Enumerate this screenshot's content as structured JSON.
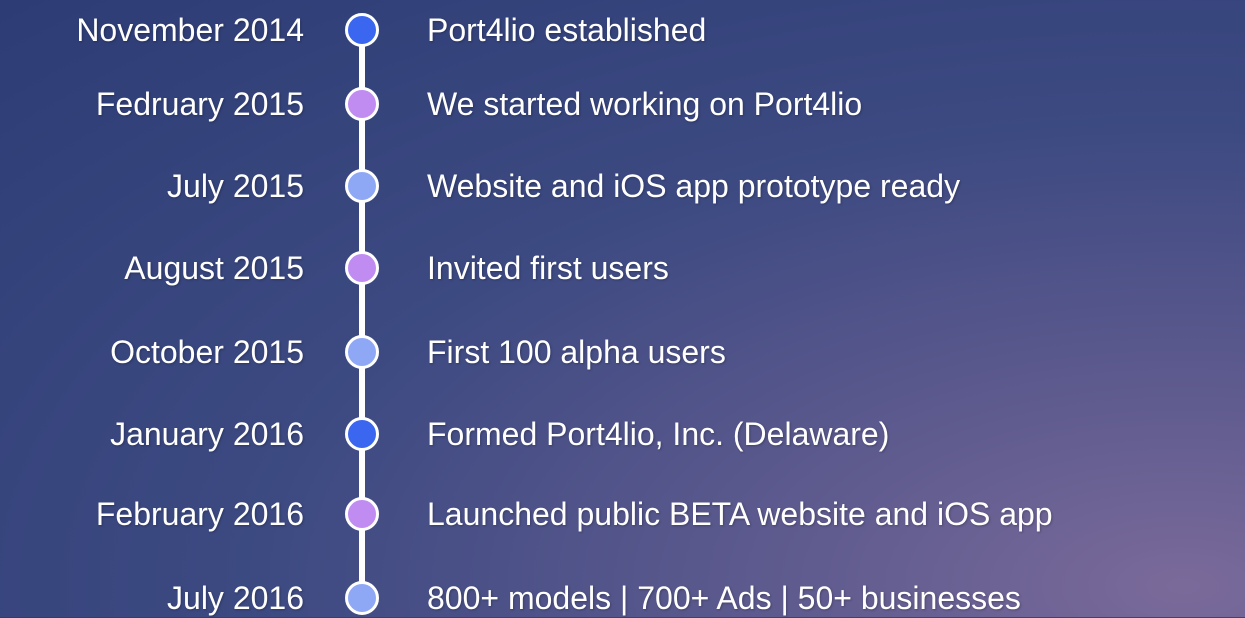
{
  "timeline": [
    {
      "date": "November 2014",
      "event": "Port4lio established",
      "dot_color": "#3b66f0"
    },
    {
      "date": "Fedruary 2015",
      "event": "We started working on Port4lio",
      "dot_color": "#c08cf2"
    },
    {
      "date": "July 2015",
      "event": "Website and iOS app prototype ready",
      "dot_color": "#8fa8f5"
    },
    {
      "date": "August 2015",
      "event": "Invited first users",
      "dot_color": "#c08cf2"
    },
    {
      "date": "October 2015",
      "event": "First 100 alpha users",
      "dot_color": "#8fa8f5"
    },
    {
      "date": "January 2016",
      "event": "Formed Port4lio, Inc. (Delaware)",
      "dot_color": "#3b66f0"
    },
    {
      "date": "February 2016",
      "event": "Launched public BETA website and iOS app",
      "dot_color": "#c08cf2"
    },
    {
      "date": "July 2016",
      "event": "800+ models | 700+ Ads | 50+ businesses",
      "dot_color": "#8fa8f5"
    }
  ]
}
